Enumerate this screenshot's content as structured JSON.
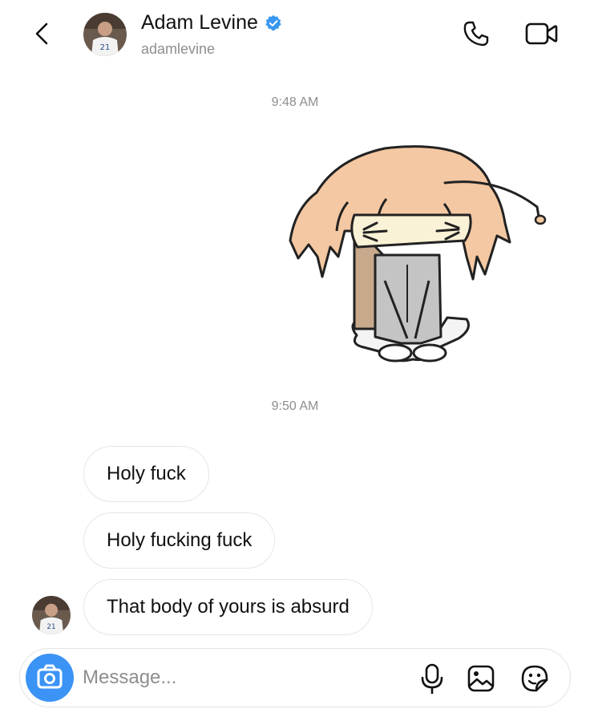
{
  "header": {
    "name": "Adam Levine",
    "username": "adamlevine",
    "avatar_jersey_number": "21",
    "verified": true
  },
  "thread": {
    "timestamp_1": "9:48 AM",
    "sticker_icon": "anime-girl-sticker",
    "timestamp_2": "9:50 AM",
    "messages": [
      {
        "text": "Holy fuck"
      },
      {
        "text": "Holy fucking fuck"
      },
      {
        "text": "That body of yours is absurd"
      }
    ]
  },
  "composer": {
    "placeholder": "Message...",
    "value": ""
  },
  "colors": {
    "accent": "#3b93f5",
    "verified": "#3897f0",
    "muted_text": "#8e8e8e",
    "bubble_border": "#e6e6e6"
  }
}
